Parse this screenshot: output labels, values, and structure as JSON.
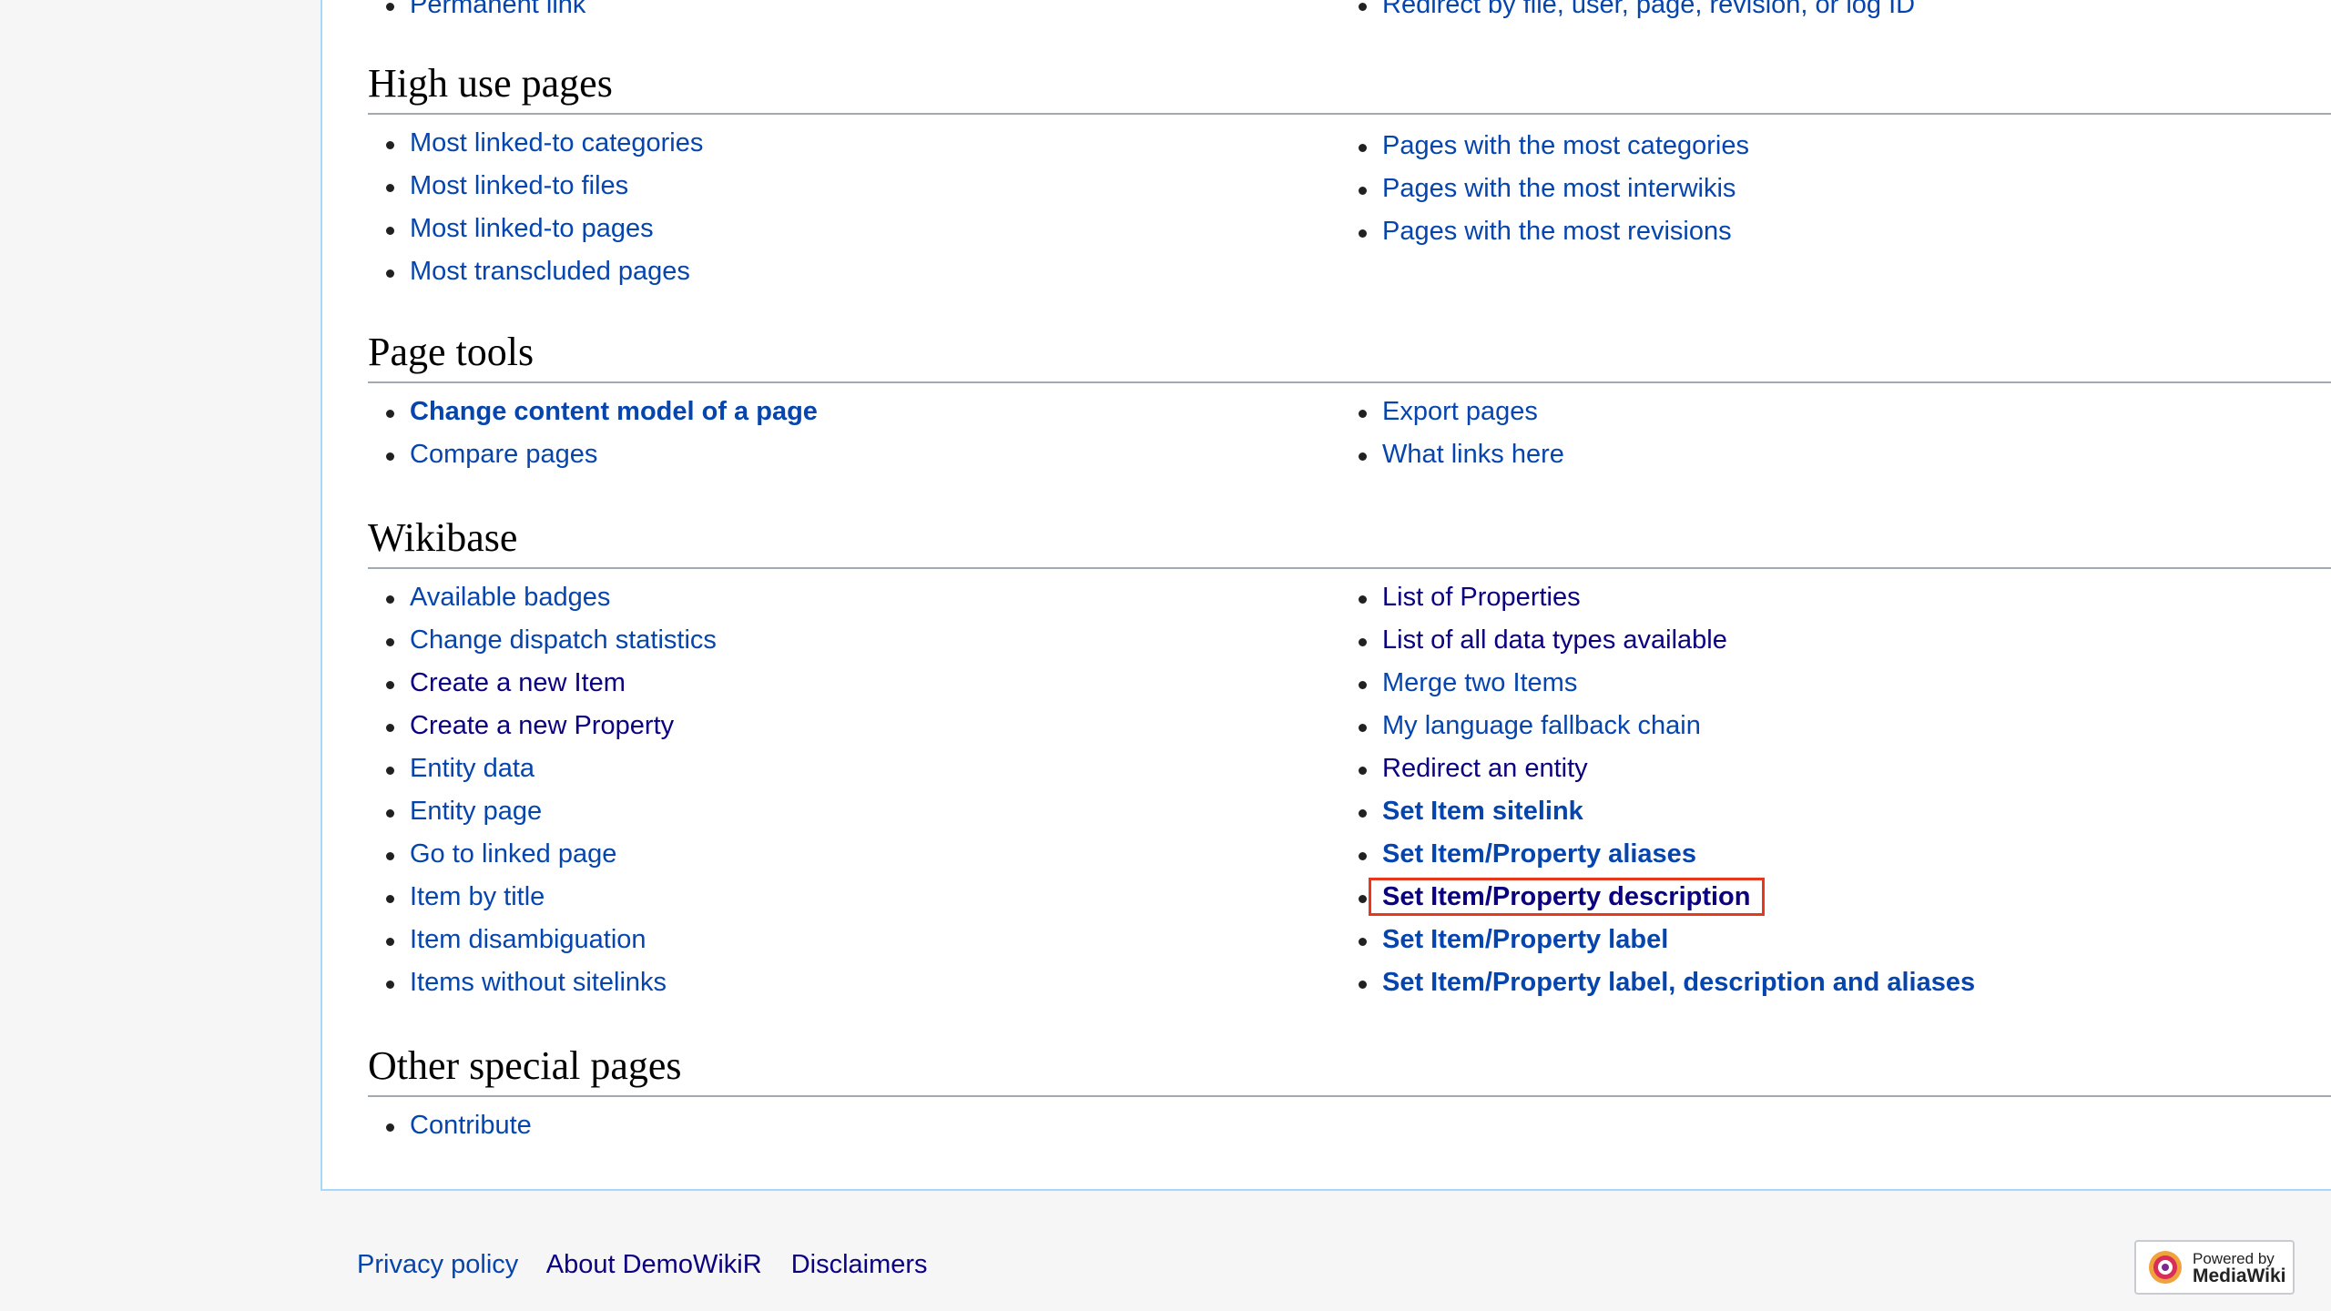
{
  "top_partial": {
    "left": "Permanent link",
    "right": "Redirect by file, user, page, revision, or log ID"
  },
  "sections": {
    "high_use": {
      "title": "High use pages",
      "left": [
        "Most linked-to categories",
        "Most linked-to files",
        "Most linked-to pages",
        "Most transcluded pages"
      ],
      "right": [
        "Pages with the most categories",
        "Pages with the most interwikis",
        "Pages with the most revisions"
      ]
    },
    "page_tools": {
      "title": "Page tools",
      "left": [
        "Change content model of a page",
        "Compare pages"
      ],
      "right": [
        "Export pages",
        "What links here"
      ]
    },
    "wikibase": {
      "title": "Wikibase",
      "left": [
        "Available badges",
        "Change dispatch statistics",
        "Create a new Item",
        "Create a new Property",
        "Entity data",
        "Entity page",
        "Go to linked page",
        "Item by title",
        "Item disambiguation",
        "Items without sitelinks"
      ],
      "right": [
        "List of Properties",
        "List of all data types available",
        "Merge two Items",
        "My language fallback chain",
        "Redirect an entity",
        "Set Item sitelink",
        "Set Item/Property aliases",
        "Set Item/Property description",
        "Set Item/Property label",
        "Set Item/Property label, description and aliases"
      ]
    },
    "other": {
      "title": "Other special pages",
      "left": [
        "Contribute"
      ]
    }
  },
  "footer": {
    "links": [
      "Privacy policy",
      "About DemoWikiR",
      "Disclaimers"
    ],
    "powered_by_line1": "Powered by",
    "powered_by_line2": "MediaWiki"
  },
  "colors": {
    "link": "#0645ad",
    "visited_link": "#0b0080",
    "highlight_box": "#e8371b",
    "content_border": "#a7d7f9"
  }
}
